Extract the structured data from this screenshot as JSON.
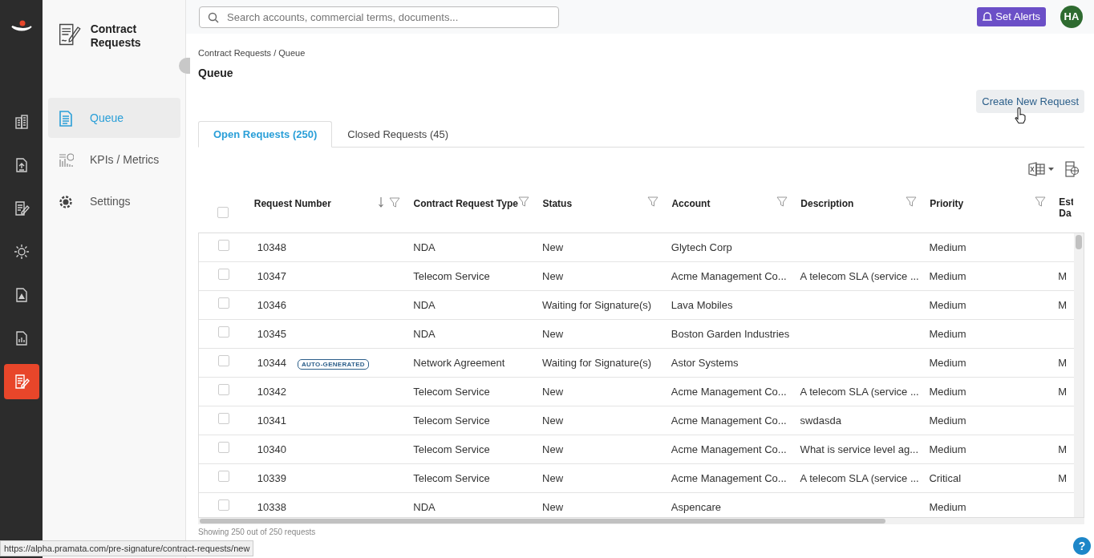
{
  "app": {
    "title": "Contract Requests"
  },
  "rail": [
    {
      "selected": false
    },
    {
      "selected": false
    },
    {
      "selected": false
    },
    {
      "selected": false
    },
    {
      "selected": false
    },
    {
      "selected": false
    },
    {
      "selected": true
    }
  ],
  "sidebar": {
    "items": [
      {
        "label": "Queue",
        "selected": true
      },
      {
        "label": "KPIs / Metrics",
        "selected": false
      },
      {
        "label": "Settings",
        "selected": false
      }
    ]
  },
  "search": {
    "placeholder": "Search accounts, commercial terms, documents..."
  },
  "alerts_button": "Set Alerts",
  "avatar": "HA",
  "breadcrumb": "Contract Requests / Queue",
  "page_title": "Queue",
  "create_button": "Create New Request",
  "tabs": [
    {
      "label": "Open Requests (250)",
      "selected": true
    },
    {
      "label": "Closed Requests (45)",
      "selected": false
    }
  ],
  "table": {
    "select_all_checked": false,
    "columns": [
      {
        "label": "Request Number",
        "sorted_descending": true,
        "filter": true
      },
      {
        "label": "Contract Request Type",
        "filter": true
      },
      {
        "label": "Status",
        "filter": true
      },
      {
        "label": "Account",
        "filter": true
      },
      {
        "label": "Description",
        "filter": true
      },
      {
        "label": "Priority",
        "filter": true
      },
      {
        "label": "Est Da",
        "filter": false
      }
    ],
    "rows": [
      {
        "checked": false,
        "cells": [
          "10348",
          "NDA",
          "New",
          "Glytech Corp",
          "",
          "Medium",
          ""
        ]
      },
      {
        "checked": false,
        "cells": [
          "10347",
          "Telecom Service",
          "New",
          "Acme Management Co...",
          "A telecom SLA (service ...",
          "Medium",
          "M"
        ]
      },
      {
        "checked": false,
        "cells": [
          "10346",
          "NDA",
          "Waiting for Signature(s)",
          "Lava Mobiles",
          "",
          "Medium",
          "M"
        ]
      },
      {
        "checked": false,
        "cells": [
          "10345",
          "NDA",
          "New",
          "Boston Garden Industries",
          "",
          "Medium",
          ""
        ]
      },
      {
        "checked": false,
        "badge": "AUTO-GENERATED",
        "cells": [
          "10344",
          "Network Agreement",
          "Waiting for Signature(s)",
          "Astor Systems",
          "",
          "Medium",
          "M"
        ]
      },
      {
        "checked": false,
        "cells": [
          "10342",
          "Telecom Service",
          "New",
          "Acme Management Co...",
          "A telecom SLA (service ...",
          "Medium",
          "M"
        ]
      },
      {
        "checked": false,
        "cells": [
          "10341",
          "Telecom Service",
          "New",
          "Acme Management Co...",
          "swdasda",
          "Medium",
          ""
        ]
      },
      {
        "checked": false,
        "cells": [
          "10340",
          "Telecom Service",
          "New",
          "Acme Management Co...",
          "What is service level ag...",
          "Medium",
          "M"
        ]
      },
      {
        "checked": false,
        "cells": [
          "10339",
          "Telecom Service",
          "New",
          "Acme Management Co...",
          "A telecom SLA (service ...",
          "Critical",
          "M"
        ]
      },
      {
        "checked": false,
        "cells": [
          "10338",
          "NDA",
          "New",
          "Aspencare",
          "",
          "Medium",
          ""
        ]
      }
    ]
  },
  "footer": "Showing 250 out of 250 requests",
  "status_url": "https://alpha.pramata.com/pre-signature/contract-requests/new",
  "help": "?"
}
